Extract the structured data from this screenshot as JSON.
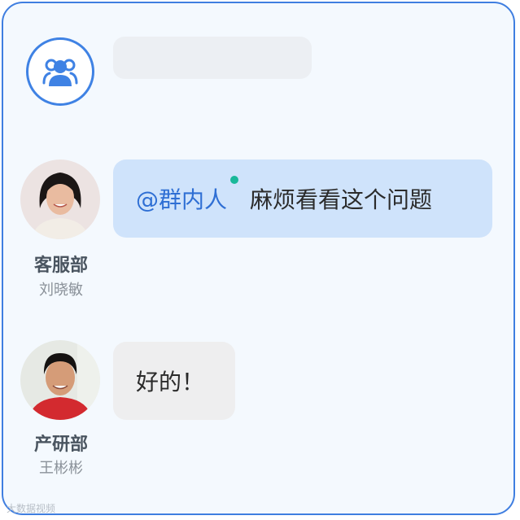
{
  "chat": {
    "group_icon": "group-icon",
    "title_placeholder": ""
  },
  "messages": [
    {
      "department": "客服部",
      "sender": "刘晓敏",
      "mention": "@群内人",
      "text": "麻烦看看这个问题"
    },
    {
      "department": "产研部",
      "sender": "王彬彬",
      "text": "好的！"
    }
  ],
  "watermark": "大数据视频",
  "colors": {
    "border": "#3f7ee0",
    "background": "#f4f9fe",
    "mention": "#2f6fd4",
    "bubble_incoming": "#cfe3fb",
    "bubble_reply": "#eeeeef",
    "online_dot": "#19b89a"
  }
}
